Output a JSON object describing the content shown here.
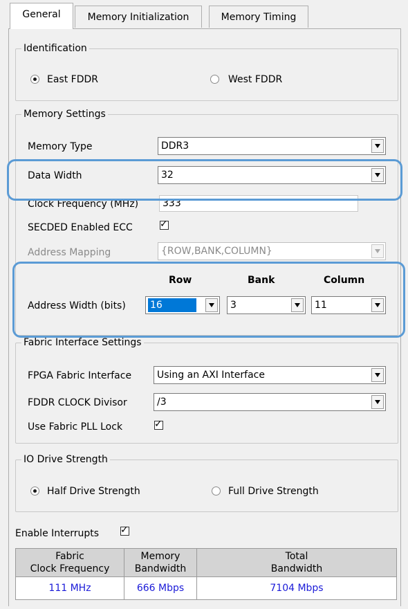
{
  "tabs": [
    {
      "label": "General"
    },
    {
      "label": "Memory Initialization"
    },
    {
      "label": "Memory Timing"
    }
  ],
  "identification": {
    "title": "Identification",
    "options": [
      {
        "label": "East FDDR",
        "selected": true
      },
      {
        "label": "West FDDR",
        "selected": false
      }
    ]
  },
  "memory_settings": {
    "title": "Memory Settings",
    "memory_type": {
      "label": "Memory Type",
      "value": "DDR3"
    },
    "data_width": {
      "label": "Data Width",
      "value": "32"
    },
    "clock_frequency": {
      "label": "Clock Frequency (MHz)",
      "value": "333"
    },
    "secded": {
      "label": "SECDED Enabled ECC",
      "checked": true
    },
    "address_mapping": {
      "label": "Address Mapping",
      "value": "{ROW,BANK,COLUMN}"
    },
    "address_width": {
      "label": "Address Width (bits)",
      "columns": [
        "Row",
        "Bank",
        "Column"
      ],
      "values": [
        "16",
        "3",
        "11"
      ]
    }
  },
  "fabric_interface": {
    "title": "Fabric Interface Settings",
    "fpga_fabric_interface": {
      "label": "FPGA Fabric Interface",
      "value": "Using an AXI Interface"
    },
    "fddr_clock_divisor": {
      "label": "FDDR CLOCK Divisor",
      "value": "/3"
    },
    "use_fabric_pll_lock": {
      "label": "Use Fabric PLL Lock",
      "checked": true
    }
  },
  "io_drive_strength": {
    "title": "IO Drive Strength",
    "options": [
      {
        "label": "Half Drive Strength",
        "selected": true
      },
      {
        "label": "Full Drive Strength",
        "selected": false
      }
    ]
  },
  "enable_interrupts": {
    "label": "Enable Interrupts",
    "checked": true
  },
  "bandwidth_table": {
    "headers": [
      [
        "Fabric",
        "Clock Frequency"
      ],
      [
        "Memory",
        "Bandwidth"
      ],
      [
        "Total",
        "Bandwidth"
      ]
    ],
    "values": [
      "111 MHz",
      "666 Mbps",
      "7104 Mbps"
    ]
  },
  "colors": {
    "highlight": "#5b9bd5",
    "value_text": "#1b1bd8",
    "selection": "#0078d7"
  }
}
